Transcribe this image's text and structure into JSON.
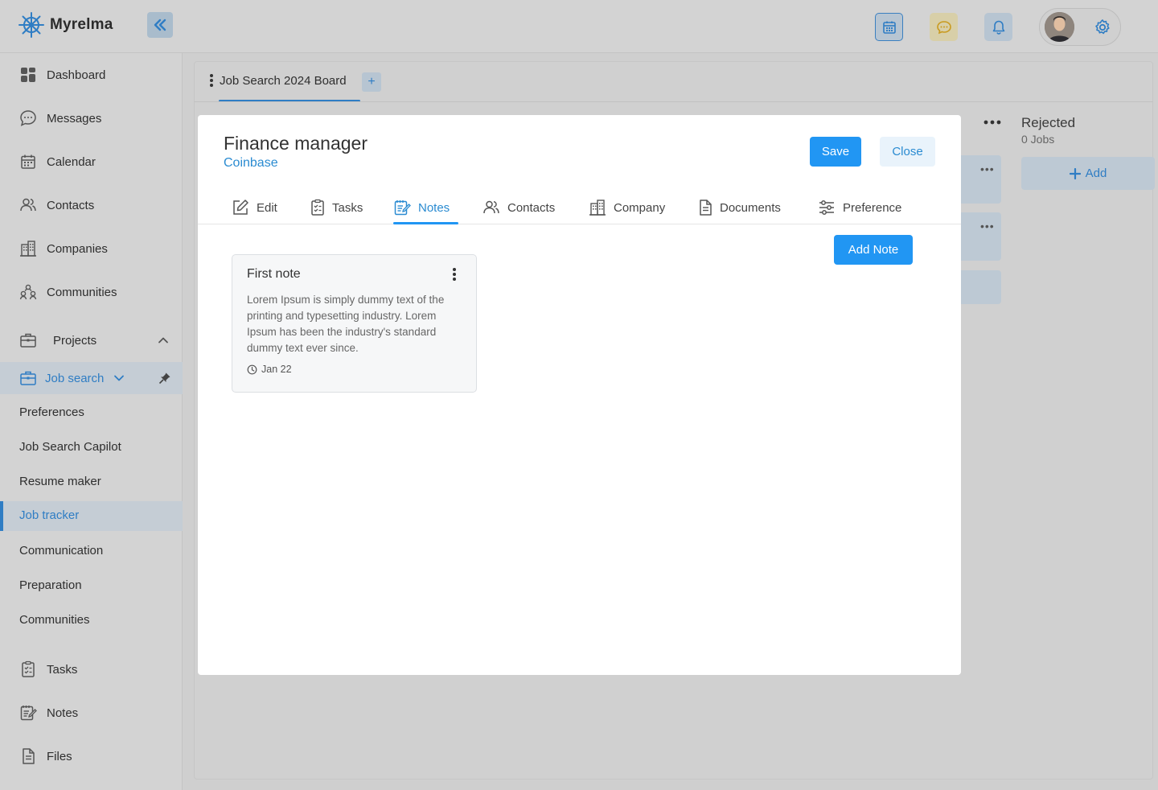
{
  "app": {
    "name": "Myrelma"
  },
  "header": {
    "icons": [
      "calendar-icon",
      "chat-icon",
      "bell-icon",
      "avatar",
      "gear-icon"
    ]
  },
  "sidebar": {
    "items": [
      {
        "label": "Dashboard",
        "icon": "dashboard-icon"
      },
      {
        "label": "Messages",
        "icon": "messages-icon"
      },
      {
        "label": "Calendar",
        "icon": "calendar-icon"
      },
      {
        "label": "Contacts",
        "icon": "contacts-icon"
      },
      {
        "label": "Companies",
        "icon": "companies-icon"
      },
      {
        "label": "Communities",
        "icon": "communities-icon"
      }
    ],
    "projects_label": "Projects",
    "job_search_label": "Job search",
    "sub_items": [
      "Preferences",
      "Job Search Capilot",
      "Resume maker",
      "Job tracker",
      "Communication",
      "Preparation",
      "Communities"
    ],
    "active_sub_item": "Job tracker",
    "bottom_items": [
      {
        "label": "Tasks",
        "icon": "tasks-icon"
      },
      {
        "label": "Notes",
        "icon": "notes-icon"
      },
      {
        "label": "Files",
        "icon": "files-icon"
      }
    ]
  },
  "board": {
    "tab_label": "Job Search 2024 Board",
    "add_label": "+",
    "column": {
      "title": "Rejected",
      "count": "0 Jobs",
      "add_label": "Add"
    }
  },
  "modal": {
    "title": "Finance manager",
    "company": "Coinbase",
    "save_label": "Save",
    "close_label": "Close",
    "tabs": [
      {
        "label": "Edit",
        "icon": "edit-icon"
      },
      {
        "label": "Tasks",
        "icon": "tasks-icon"
      },
      {
        "label": "Notes",
        "icon": "notes-icon"
      },
      {
        "label": "Contacts",
        "icon": "contacts-icon"
      },
      {
        "label": "Company",
        "icon": "company-icon"
      },
      {
        "label": "Documents",
        "icon": "document-icon"
      },
      {
        "label": "Preference",
        "icon": "sliders-icon"
      }
    ],
    "active_tab": "Notes",
    "add_note_label": "Add Note",
    "notes": [
      {
        "title": "First note",
        "body": "Lorem Ipsum is simply dummy text of the printing and typesetting industry. Lorem Ipsum has been the industry's standard dummy text ever since.",
        "date": "Jan 22"
      }
    ]
  },
  "colors": {
    "accent": "#2196f3",
    "link": "#2a8bd1",
    "overlay": "#cfcfcf"
  }
}
